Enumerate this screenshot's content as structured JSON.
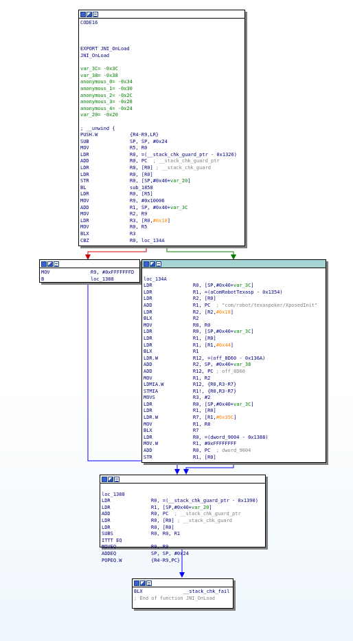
{
  "colors": {
    "edge_true": "#008000",
    "edge_false": "#cc0000",
    "edge_uncond": "#0000ff",
    "code_text": "#000080",
    "comment": "#808080",
    "stack_var": "#008000",
    "immediate": "#ff8000"
  },
  "icons": [
    "graph-view-icon",
    "edit-icon",
    "comment-icon"
  ],
  "nodes": {
    "entry": {
      "lines": [
        {
          "t": "CODE16"
        },
        {
          "t": ""
        },
        {
          "t": ""
        },
        {
          "t": ""
        },
        {
          "t": "EXPORT JNI_OnLoad"
        },
        {
          "t": "JNI_OnLoad"
        },
        {
          "t": ""
        },
        {
          "t": "var_3C= -0x3C",
          "cls": "green"
        },
        {
          "t": "var_38= -0x38",
          "cls": "green"
        },
        {
          "t": "anonymous_0= -0x34",
          "cls": "green"
        },
        {
          "t": "anonymous_1= -0x30",
          "cls": "green"
        },
        {
          "t": "anonymous_2= -0x2C",
          "cls": "green"
        },
        {
          "t": "anonymous_3= -0x28",
          "cls": "green"
        },
        {
          "t": "anonymous_4= -0x24",
          "cls": "green"
        },
        {
          "t": "var_20= -0x20",
          "cls": "green"
        },
        {
          "t": ""
        },
        {
          "t": "; __unwind {"
        },
        {
          "m": "PUSH.W",
          "o": "{R4-R9,LR}"
        },
        {
          "m": "SUB",
          "o": "SP, SP, #0x24"
        },
        {
          "m": "MOV",
          "o": "R5, R0"
        },
        {
          "m": "LDR",
          "o": "R0, =(__stack_chk_guard_ptr - 0x1326)"
        },
        {
          "m": "ADD",
          "o": "R0, PC",
          "c": "  ; __stack_chk_guard_ptr"
        },
        {
          "m": "LDR",
          "o": "R0, [R0]",
          "c": " ; __stack_chk_guard"
        },
        {
          "m": "LDR",
          "o": "R0, [R0]"
        },
        {
          "m": "STR",
          "o": "R0, [SP,#0x40+var_20]"
        },
        {
          "m": "BL",
          "o": "sub_1858"
        },
        {
          "m": "LDR",
          "o": "R0, [R5]"
        },
        {
          "m": "MOV",
          "o": "R9, #0x10006"
        },
        {
          "m": "ADD",
          "o": "R1, SP, #0x40+var_3C"
        },
        {
          "m": "MOV",
          "o": "R2, R9"
        },
        {
          "m": "LDR",
          "o": "R3, [R0,#0x18]"
        },
        {
          "m": "MOV",
          "o": "R0, R5"
        },
        {
          "m": "BLX",
          "o": "R3"
        },
        {
          "m": "CBZ",
          "o": "R0, loc_134A"
        }
      ]
    },
    "fail_path": {
      "lines": [
        {
          "m": "MOV",
          "o": "R9, #0xFFFFFFFD",
          "w": 72
        },
        {
          "m": "B",
          "o": "loc_1388",
          "w": 72
        }
      ]
    },
    "loc_134A": {
      "lines": [
        {
          "t": ""
        },
        {
          "t": "loc_134A"
        },
        {
          "m": "LDR",
          "o": "R0, [SP,#0x40+var_3C]"
        },
        {
          "m": "LDR",
          "o": "R1, =(aComRobotTexasp - 0x1354)"
        },
        {
          "m": "LDR",
          "o": "R2, [R0]"
        },
        {
          "m": "ADD",
          "o": "R1, PC",
          "c": "  ; \"com/robot/texaspoker/XposedInit\""
        },
        {
          "m": "LDR",
          "o": "R2, [R2,#0x18]"
        },
        {
          "m": "BLX",
          "o": "R2"
        },
        {
          "m": "MOV",
          "o": "R8, R0"
        },
        {
          "m": "LDR",
          "o": "R0, [SP,#0x40+var_3C]"
        },
        {
          "m": "LDR",
          "o": "R1, [R0]"
        },
        {
          "m": "LDR",
          "o": "R1, [R1,#0x44]"
        },
        {
          "m": "BLX",
          "o": "R1"
        },
        {
          "m": "LDR.W",
          "o": "R12, =(off_8D60 - 0x136A)"
        },
        {
          "m": "ADD",
          "o": "R2, SP, #0x40+var_38"
        },
        {
          "m": "ADD",
          "o": "R12, PC",
          "c": " ; off_8D60"
        },
        {
          "m": "MOV",
          "o": "R1, R2"
        },
        {
          "m": "LDMIA.W",
          "o": "R12, {R0,R3-R7}"
        },
        {
          "m": "STMIA",
          "o": "R1!, {R0,R3-R7}"
        },
        {
          "m": "MOVS",
          "o": "R3, #2"
        },
        {
          "m": "LDR",
          "o": "R0, [SP,#0x40+var_3C]"
        },
        {
          "m": "LDR",
          "o": "R1, [R0]"
        },
        {
          "m": "LDR.W",
          "o": "R7, [R1,#0x35C]"
        },
        {
          "m": "MOV",
          "o": "R1, R8"
        },
        {
          "m": "BLX",
          "o": "R7"
        },
        {
          "m": "LDR",
          "o": "R0, =(dword_9004 - 0x1388)"
        },
        {
          "m": "MOV.W",
          "o": "R1, #0xFFFFFFFF"
        },
        {
          "m": "ADD",
          "o": "R0, PC",
          "c": "  ; dword_9004"
        },
        {
          "m": "STR",
          "o": "R1, [R0]"
        }
      ]
    },
    "loc_1388": {
      "lines": [
        {
          "t": ""
        },
        {
          "t": "loc_1388"
        },
        {
          "m": "LDR",
          "o": "R0, =(__stack_chk_guard_ptr - 0x1390)"
        },
        {
          "m": "LDR",
          "o": "R1, [SP,#0x40+var_20]"
        },
        {
          "m": "ADD",
          "o": "R0, PC",
          "c": "  ; __stack_chk_guard_ptr"
        },
        {
          "m": "LDR",
          "o": "R0, [R0]",
          "c": " ; __stack_chk_guard"
        },
        {
          "m": "LDR",
          "o": "R0, [R0]"
        },
        {
          "m": "SUBS",
          "o": "R0, R0, R1"
        },
        {
          "t": "ITTT EQ"
        },
        {
          "m": "MOVEQ",
          "o": "R0, R9"
        },
        {
          "m": "ADDEQ",
          "o": "SP, SP, #0x24"
        },
        {
          "m": "POPEQ.W",
          "o": "{R4-R9,PC}"
        }
      ]
    },
    "stack_fail": {
      "lines": [
        {
          "m": "BLX",
          "o": "__stack_chk_fail"
        },
        {
          "t": "; End of function JNI_OnLoad",
          "cls": "cmt"
        }
      ]
    }
  }
}
